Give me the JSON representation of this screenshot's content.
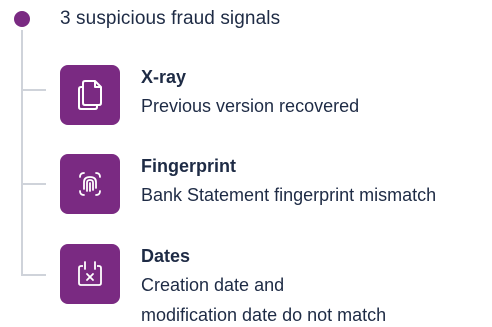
{
  "colors": {
    "accent": "#7a2a82",
    "text": "#1e2b45",
    "connector": "#cfd3da"
  },
  "header": {
    "title": "3 suspicious fraud signals"
  },
  "signals": [
    {
      "icon": "copy-documents-icon",
      "title": "X-ray",
      "description_lines": [
        "Previous version recovered"
      ]
    },
    {
      "icon": "fingerprint-icon",
      "title": "Fingerprint",
      "description_lines": [
        "Bank Statement fingerprint mismatch"
      ]
    },
    {
      "icon": "calendar-x-icon",
      "title": "Dates",
      "description_lines": [
        "Creation date and",
        "modification date do not match"
      ]
    }
  ]
}
